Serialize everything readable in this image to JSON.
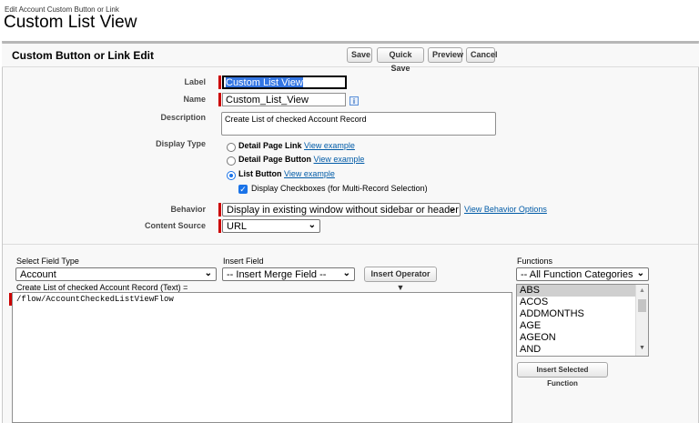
{
  "header": {
    "supertitle": "Edit Account Custom Button or Link",
    "title": "Custom List View"
  },
  "panel": {
    "title": "Custom Button or Link Edit",
    "buttons": {
      "save": "Save",
      "quick_save": "Quick Save",
      "preview": "Preview",
      "cancel": "Cancel"
    }
  },
  "form": {
    "label": {
      "caption": "Label",
      "value": "Custom List View"
    },
    "name": {
      "caption": "Name",
      "value": "Custom_List_View",
      "info_icon": "i"
    },
    "description": {
      "caption": "Description",
      "value": "Create List of checked Account Record"
    },
    "display_type": {
      "caption": "Display Type",
      "options": [
        {
          "label": "Detail Page Link",
          "link": "View example",
          "selected": false
        },
        {
          "label": "Detail Page Button",
          "link": "View example",
          "selected": false
        },
        {
          "label": "List Button",
          "link": "View example",
          "selected": true
        }
      ],
      "checkbox": {
        "label": "Display Checkboxes (for Multi-Record Selection)",
        "checked": true
      }
    },
    "behavior": {
      "caption": "Behavior",
      "value": "Display in existing window without sidebar or header",
      "link": "View Behavior Options"
    },
    "content_source": {
      "caption": "Content Source",
      "value": "URL"
    }
  },
  "formula": {
    "select_field_type": {
      "caption": "Select Field Type",
      "value": "Account"
    },
    "insert_field": {
      "caption": "Insert Field",
      "value": "-- Insert Merge Field --"
    },
    "insert_operator": "Insert Operator",
    "editor_caption": "Create List of checked Account Record (Text) =",
    "editor_value": "/flow/AccountCheckedListViewFlow",
    "functions": {
      "caption": "Functions",
      "category": "-- All Function Categories --",
      "items": [
        "ABS",
        "ACOS",
        "ADDMONTHS",
        "AGE",
        "AGEON",
        "AND"
      ],
      "insert_button": "Insert Selected Function"
    }
  },
  "colors": {
    "required": "#cc0000",
    "link": "#015ba7",
    "accent": "#1a73e8"
  }
}
